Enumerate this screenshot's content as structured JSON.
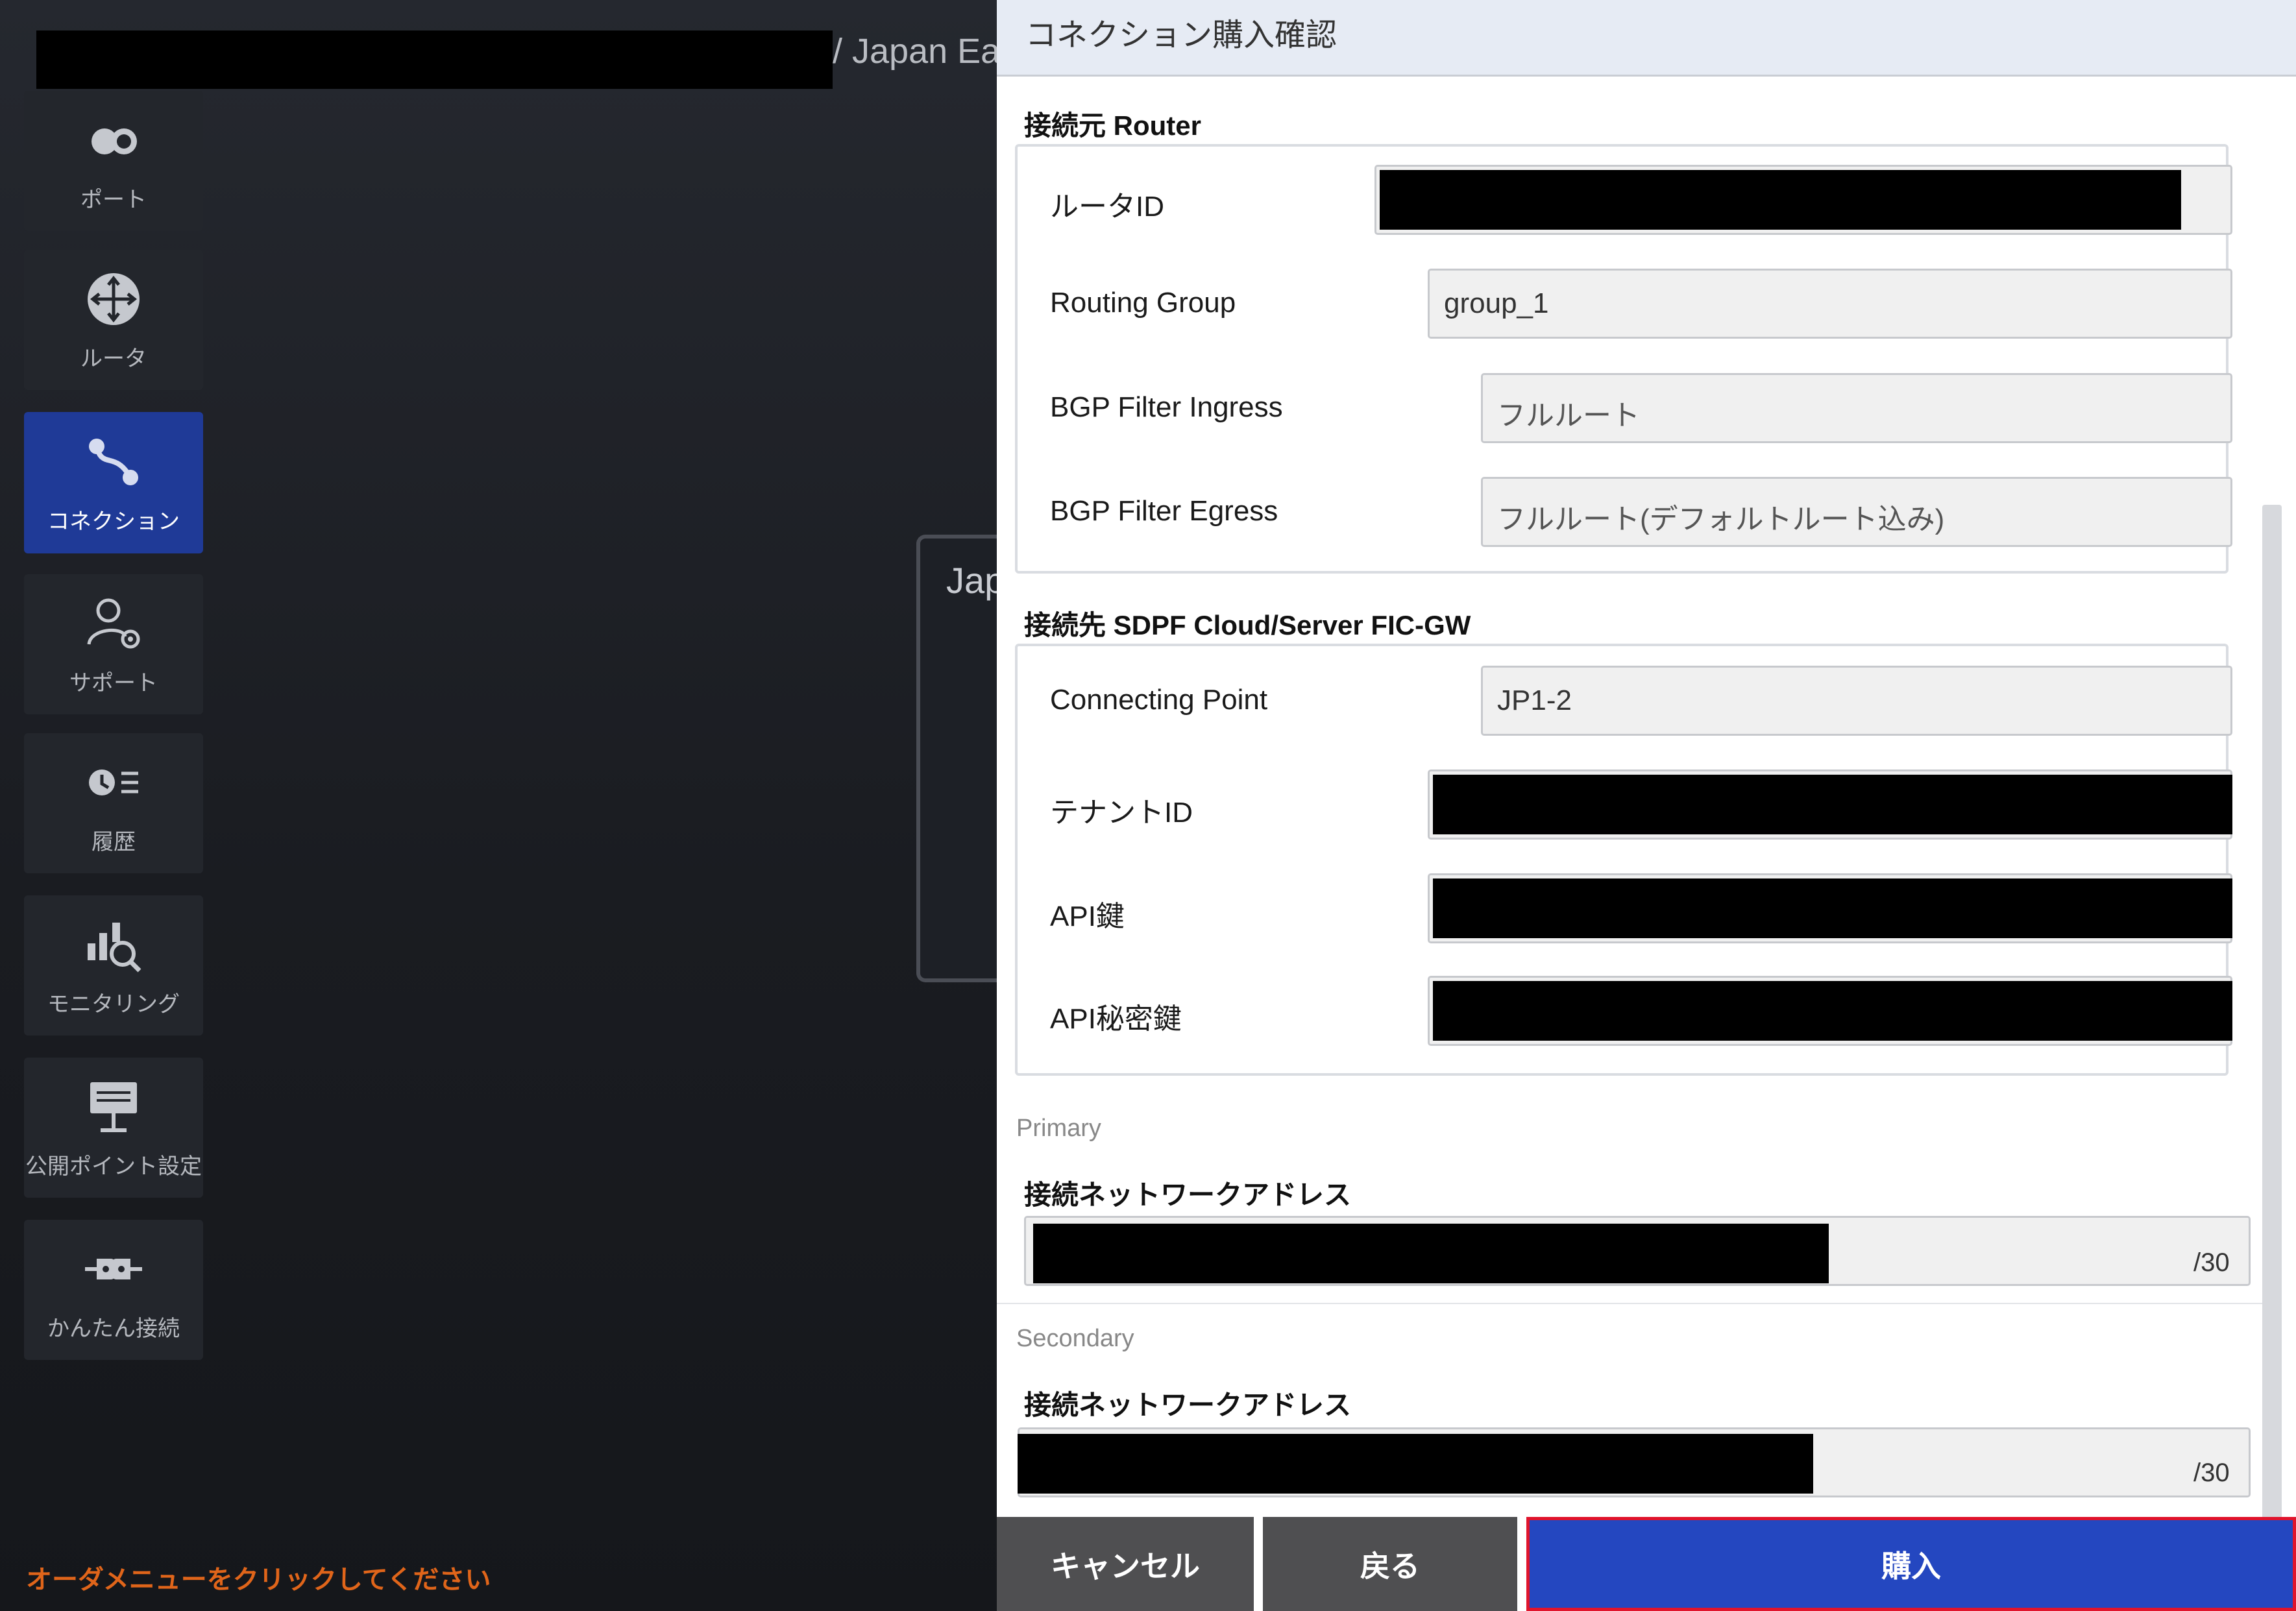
{
  "breadcrumb": {
    "suffix": "/ Japan Ea"
  },
  "sidebar": {
    "items": [
      {
        "label": "ポート",
        "icon": "port-icon",
        "active": false
      },
      {
        "label": "ルータ",
        "icon": "router-icon",
        "active": false
      },
      {
        "label": "コネクション",
        "icon": "connection-icon",
        "active": true
      },
      {
        "label": "サポート",
        "icon": "support-icon",
        "active": false
      },
      {
        "label": "履歴",
        "icon": "history-icon",
        "active": false
      },
      {
        "label": "モニタリング",
        "icon": "monitoring-icon",
        "active": false
      },
      {
        "label": "公開ポイント設定",
        "icon": "public-point-icon",
        "active": false
      },
      {
        "label": "かんたん接続",
        "icon": "easy-connect-icon",
        "active": false
      }
    ]
  },
  "background_card": {
    "text": "Jap"
  },
  "order_hint": "オーダメニューをクリックしてください",
  "modal": {
    "title": "コネクション購入確認",
    "source_section": {
      "title": "接続元 Router",
      "router_id_label": "ルータID",
      "routing_group_label": "Routing Group",
      "routing_group_value": "group_1",
      "bgp_ingress_label": "BGP Filter Ingress",
      "bgp_ingress_value": "フルルート",
      "bgp_egress_label": "BGP Filter Egress",
      "bgp_egress_value": "フルルート(デフォルトルート込み)"
    },
    "destination_section": {
      "title": "接続先 SDPF Cloud/Server FIC-GW",
      "connecting_point_label": "Connecting Point",
      "connecting_point_value": "JP1-2",
      "tenant_id_label": "テナントID",
      "api_key_label": "API鍵",
      "api_secret_label": "API秘密鍵"
    },
    "primary": {
      "label": "Primary",
      "address_title": "接続ネットワークアドレス",
      "prefix": "/30"
    },
    "secondary": {
      "label": "Secondary",
      "address_title": "接続ネットワークアドレス",
      "prefix": "/30"
    },
    "footer": {
      "cancel_label": "キャンセル",
      "back_label": "戻る",
      "purchase_label": "購入"
    }
  },
  "colors": {
    "accent": "#2447c0",
    "active_nav": "#1f3a97",
    "hint": "#e0651a",
    "purchase_outline": "#e0142c"
  }
}
